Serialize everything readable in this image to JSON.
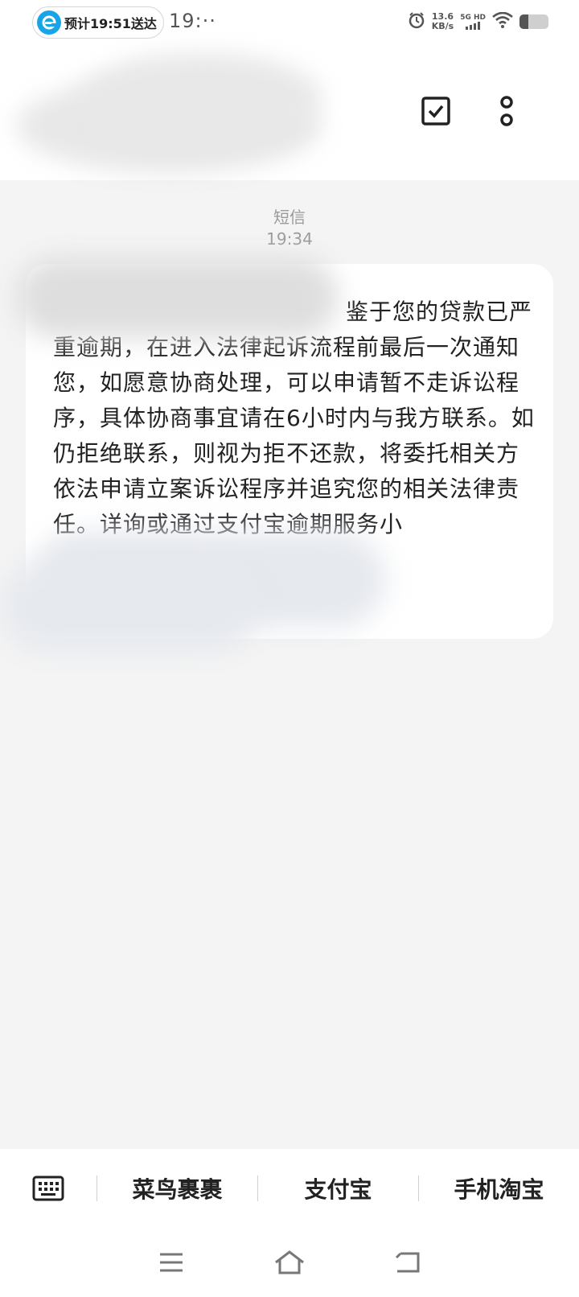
{
  "status_bar": {
    "delivery_pill": "预计19:51送达",
    "time": "19:··",
    "net_speed_value": "13.6",
    "net_speed_unit": "KB/s",
    "network_type": "5G HD",
    "battery_level": 0.3
  },
  "conversation": {
    "label": "短信",
    "time": "19:34",
    "message": "鉴于您的贷款已严重逾期，在进入法律起诉流程前最后一次通知您，如愿意协商处理，可以申请暂不走诉讼程序，具体协商事宜请在6小时内与我方联系。如仍拒绝联系，则视为拒不还款，将委托相关方依法申请立案诉讼程序并追究您的相关法律责任。详询或通过支付宝逾期服务小"
  },
  "quick_bar": {
    "items": [
      "菜鸟裹裹",
      "支付宝",
      "手机淘宝"
    ]
  },
  "colors": {
    "pill_logo": "#1aa4e8",
    "background": "#f4f4f4",
    "bubble": "#ffffff"
  }
}
